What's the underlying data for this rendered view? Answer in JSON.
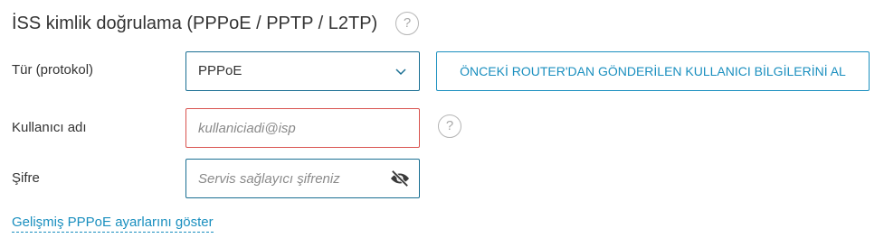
{
  "section": {
    "title": "İSS kimlik doğrulama (PPPoE / PPTP / L2TP)",
    "help_symbol": "?"
  },
  "protocol": {
    "label": "Tür (protokol)",
    "selected_value": "PPPoE"
  },
  "import_button": {
    "label": "ÖNCEKİ ROUTER'DAN GÖNDERİLEN KULLANICI BİLGİLERİNİ AL"
  },
  "username": {
    "label": "Kullanıcı adı",
    "placeholder": "kullaniciadi@isp",
    "value": "",
    "help_symbol": "?"
  },
  "password": {
    "label": "Şifre",
    "placeholder": "Servis sağlayıcı şifreniz",
    "value": "",
    "visibility_icon": "eye-slash-icon"
  },
  "advanced_link": {
    "label": "Gelişmiş PPPoE ayarlarını göster"
  },
  "colors": {
    "accent": "#1a8fbf",
    "focus_border": "#1a6f93",
    "error_border": "#d9534f",
    "text": "#333333"
  }
}
